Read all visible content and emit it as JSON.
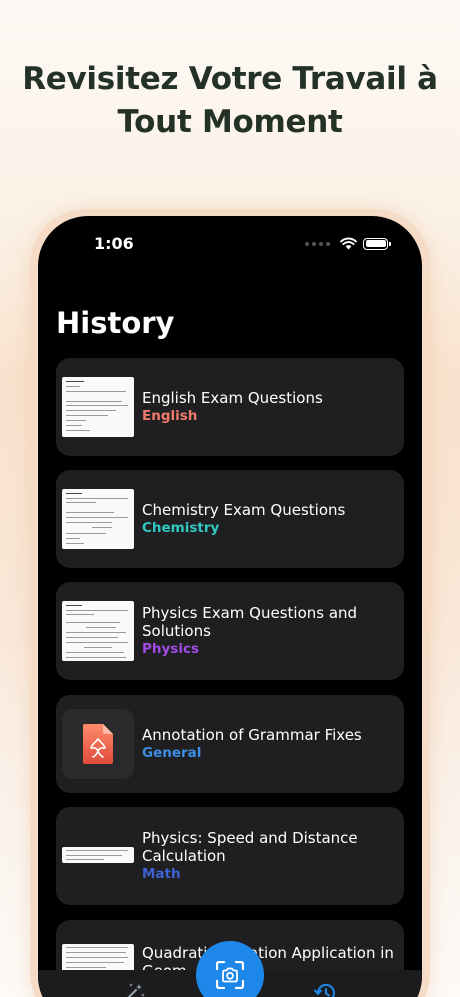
{
  "headline": [
    "Revisitez Votre Travail à",
    "Tout Moment"
  ],
  "status": {
    "time": "1:06"
  },
  "screen_title": "History",
  "colors": {
    "english": "#f07a6a",
    "chemistry": "#2fc9c1",
    "physics": "#a14be8",
    "general": "#3d8fe6",
    "math": "#3f63d6",
    "fab": "#1e88ea"
  },
  "items": [
    {
      "title": "English Exam Questions",
      "subject": "English",
      "thumb": "document"
    },
    {
      "title": "Chemistry Exam Questions",
      "subject": "Chemistry",
      "thumb": "document"
    },
    {
      "title": "Physics Exam Questions and Solutions",
      "subject": "Physics",
      "thumb": "document"
    },
    {
      "title": "Annotation of Grammar Fixes",
      "subject": "General",
      "thumb": "file-icon"
    },
    {
      "title": "Physics: Speed and Distance Calculation",
      "subject": "Math",
      "thumb": "document"
    },
    {
      "title": "Quadratic Equation Application in Geom",
      "subject": "",
      "thumb": "document"
    }
  ],
  "tabbar": {
    "left_icon": "magic-wand-icon",
    "center_icon": "scan-camera-icon",
    "right_icon": "history-icon"
  }
}
